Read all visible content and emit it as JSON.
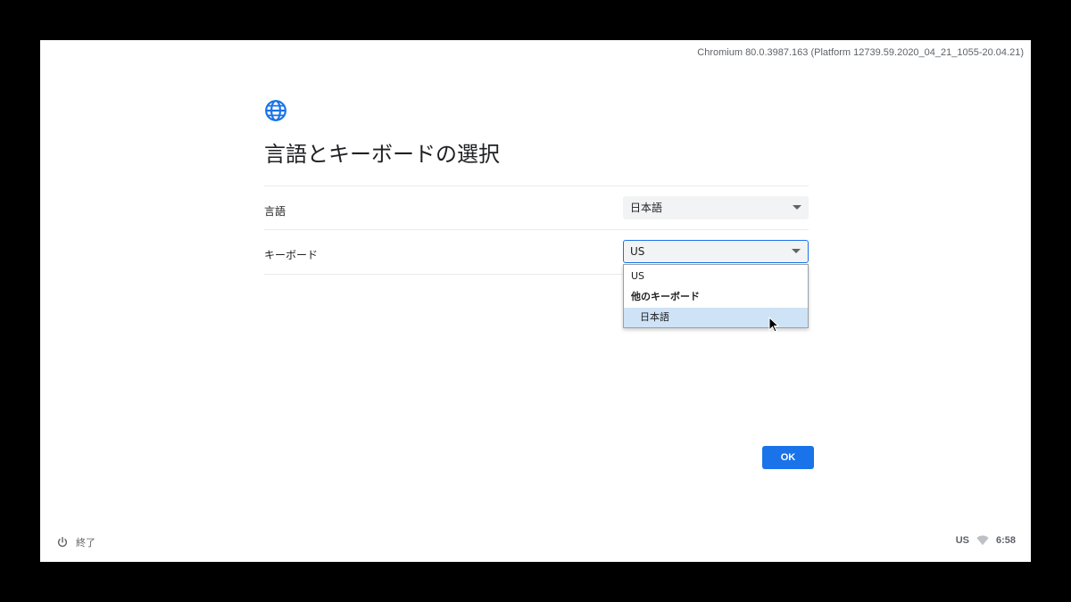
{
  "version_text": "Chromium 80.0.3987.163 (Platform 12739.59.2020_04_21_1055-20.04.21)",
  "title": "言語とキーボードの選択",
  "language": {
    "label": "言語",
    "selected": "日本語"
  },
  "keyboard": {
    "label": "キーボード",
    "selected": "US",
    "options": [
      {
        "label": "US",
        "type": "option"
      },
      {
        "label": "他のキーボード",
        "type": "group"
      },
      {
        "label": "日本語",
        "type": "option",
        "highlighted": true
      }
    ]
  },
  "ok_label": "OK",
  "shelf": {
    "shutdown_label": "終了",
    "input_method": "US",
    "time": "6:58"
  },
  "colors": {
    "accent": "#1a73e8",
    "highlight": "#cfe3f6"
  },
  "icons": [
    "globe-icon",
    "power-icon",
    "wifi-icon",
    "mouse-cursor-icon",
    "chevron-down-icon"
  ]
}
